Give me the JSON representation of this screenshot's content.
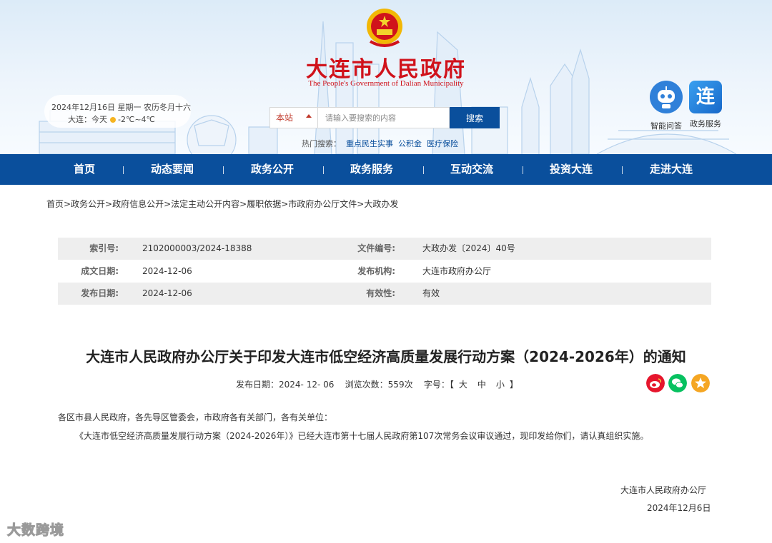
{
  "header": {
    "site_title": "大连市人民政府",
    "site_subtitle": "The People's Government of Dalian Municipality",
    "date_line": "2024年12月16日 星期一 农历冬月十六",
    "weather_city": "大连：今天",
    "weather_temp": "-2℃~4℃",
    "search": {
      "scope": "本站",
      "placeholder": "请输入要搜索的内容",
      "button": "搜索"
    },
    "hot_search": {
      "label": "热门搜索：",
      "links": [
        "重点民生实事",
        "公积金",
        "医疗保险"
      ]
    },
    "apps": [
      {
        "label": "智能问答",
        "icon": "robot-icon"
      },
      {
        "label": "政务服务",
        "icon": "lian-app-icon",
        "glyph": "连"
      }
    ]
  },
  "nav": {
    "items": [
      "首页",
      "动态要闻",
      "政务公开",
      "政务服务",
      "互动交流",
      "投资大连",
      "走进大连"
    ]
  },
  "breadcrumb": "首页>政务公开>政府信息公开>法定主动公开内容>履职依据>市政府办公厅文件>大政办发",
  "meta": {
    "index_label": "索引号:",
    "index_value": "2102000003/2024-18388",
    "docno_label": "文件编号:",
    "docno_value": "大政办发〔2024〕40号",
    "created_label": "成文日期:",
    "created_value": "2024-12-06",
    "org_label": "发布机构:",
    "org_value": "大连市政府办公厅",
    "published_label": "发布日期:",
    "published_value": "2024-12-06",
    "validity_label": "有效性:",
    "validity_value": "有效"
  },
  "article": {
    "title": "大连市人民政府办公厅关于印发大连市低空经济高质量发展行动方案（2024-2026年）的通知",
    "pub_label": "发布日期：",
    "pub_date": "2024- 12- 06",
    "views_label": "浏览次数：",
    "views": "559次",
    "font_label": "字号：",
    "bracket_open": "【",
    "font_sizes": [
      "大",
      "中",
      "小"
    ],
    "bracket_close": "】",
    "recipients": "各区市县人民政府，各先导区管委会，市政府各有关部门，各有关单位：",
    "body": "《大连市低空经济高质量发展行动方案（2024-2026年）》已经大连市第十七届人民政府第107次常务会议审议通过，现印发给你们，请认真组织实施。",
    "sign_org": "大连市人民政府办公厅",
    "sign_date": "2024年12月6日"
  },
  "share": [
    {
      "icon": "weibo-icon",
      "color": "#e6162d"
    },
    {
      "icon": "wechat-icon",
      "color": "#07c160"
    },
    {
      "icon": "favorite-star-icon",
      "color": "#f5a623"
    }
  ],
  "watermark": "大数跨境",
  "colors": {
    "nav_blue": "#0a4f9c",
    "title_red": "#d0121b"
  }
}
